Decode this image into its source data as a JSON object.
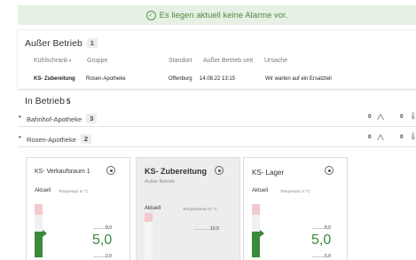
{
  "banner": {
    "text": "Es liegen aktuell keine Alarme vor."
  },
  "ausser_betrieb": {
    "title": "Außer Betrieb",
    "count": "1",
    "columns": [
      "Kühlschrank",
      "Gruppe",
      "Standort",
      "Außer Betrieb seit",
      "Ursache"
    ],
    "row": {
      "kuehlschrank": "KS- Zubereitung",
      "gruppe": "Rosen-Apotheke",
      "standort": "Offenburg",
      "seit": "14.08.22 13:15",
      "ursache": "Wir warten auf ein Ersatzteil"
    }
  },
  "in_betrieb": {
    "title": "In Betrieb",
    "count": "5",
    "groups": [
      {
        "name": "Bahnhof-Apotheke",
        "count": "3",
        "alarm_count_1": "0",
        "alarm_count_2": "0"
      },
      {
        "name": "Rosen-Apotheke",
        "count": "2",
        "alarm_count_1": "0",
        "alarm_count_2": "0"
      }
    ]
  },
  "devices": [
    {
      "name": "KS- Verkaufsraum 1",
      "aktuell_label": "Aktuell",
      "temp_label": "Temperatur in °C",
      "upper": "8,0",
      "value": "5,0",
      "lower": "2,0",
      "level_pct": 48
    },
    {
      "name": "KS- Zubereitung",
      "status": "Außer Betrieb",
      "aktuell_label": "Aktuell",
      "temp_label": "Temperaturen in °C",
      "upper": "10,0"
    },
    {
      "name": "KS- Lager",
      "aktuell_label": "Aktuell",
      "temp_label": "Temperatur in °C",
      "upper": "8,0",
      "value": "5,0",
      "lower": "5,0",
      "level_pct": 48
    }
  ],
  "colors": {
    "ok_green": "#3b8a3c",
    "banner_bg": "#e6f0e4",
    "alarm_red": "#f4c9cd"
  },
  "icons": {
    "banner": "check-circle-icon",
    "sort": "caret-down-icon",
    "alarm": "warning-triangle-icon",
    "temp": "thermometer-icon",
    "menu": "circle-dot-icon"
  }
}
